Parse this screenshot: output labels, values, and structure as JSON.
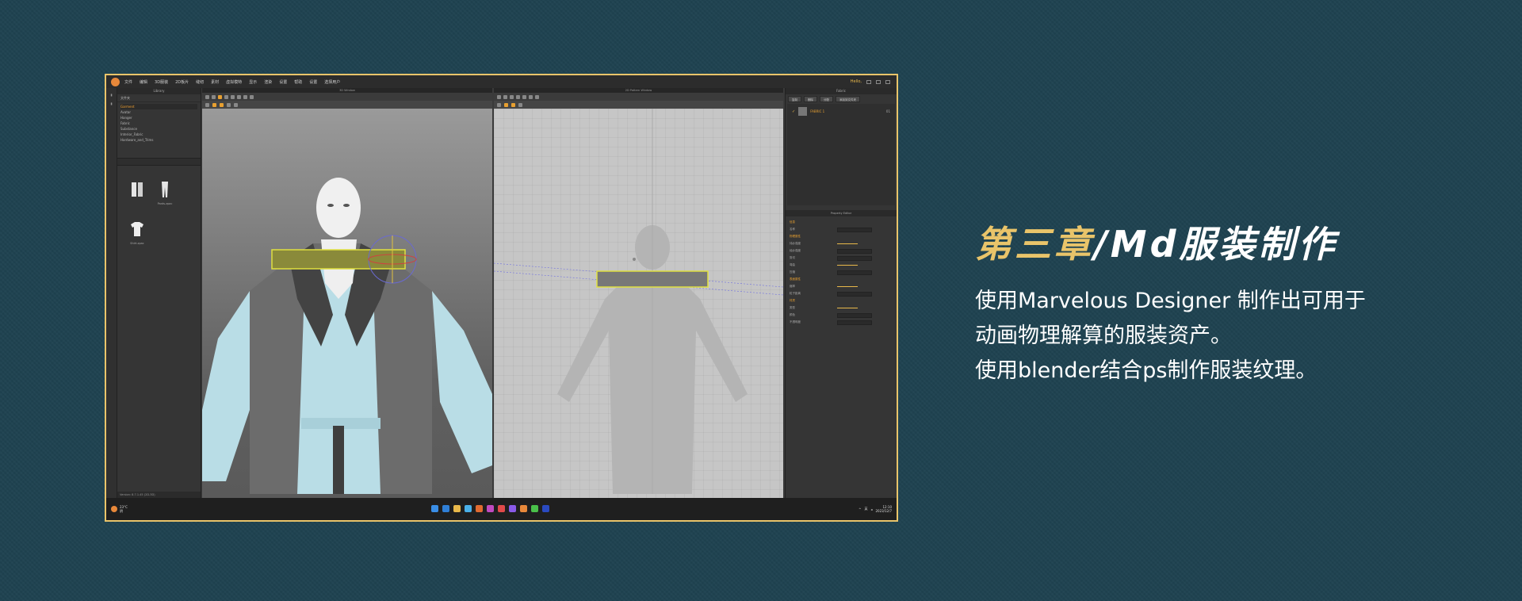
{
  "heading": {
    "primary": "第三章",
    "secondary": "/Md服装制作"
  },
  "description": [
    "使用Marvelous Designer 制作出可用于",
    "动画物理解算的服装资产。",
    "使用blender结合ps制作服装纹理。"
  ],
  "colors": {
    "background": "#1e4250",
    "accent": "#e9c46a",
    "text": "#ffffff"
  },
  "screenshot": {
    "menu": [
      "文件",
      "编辑",
      "3D服装",
      "2D板片",
      "缝纫",
      "素材",
      "虚拟模特",
      "显示",
      "渲染",
      "设置",
      "帮助",
      "设置",
      "选择用户"
    ],
    "user_name": "Hello,",
    "library": {
      "title": "Library",
      "toolbar_label": "文件夹",
      "folders": [
        "Garment",
        "Avatar",
        "Hanger",
        "Fabric",
        "Substance",
        "Interior_Fabric",
        "Hardware_and_Trims"
      ],
      "thumbnails": [
        "",
        "Pants.zpac",
        "Shirt.zpac"
      ],
      "footer": "Version: 8.7.1.45 (2D-3D)"
    },
    "view3d_title": "3D Window",
    "view2d_title": "2D Pattern Window",
    "fabric": {
      "title": "Fabric",
      "buttons": [
        "复制",
        "删除",
        "分配",
        "添加到文件夹"
      ],
      "item_name": "FABRIC 1",
      "item_count": "01"
    },
    "property_editor": {
      "title": "Property Editor",
      "rows": [
        {
          "label": "信息",
          "section": true
        },
        {
          "label": "名称",
          "section": false
        },
        {
          "label": "物理属性",
          "section": true
        },
        {
          "label": "纬纱强度",
          "section": false
        },
        {
          "label": "经纱强度",
          "section": false
        },
        {
          "label": "剪切",
          "section": false
        },
        {
          "label": "弯曲",
          "section": false
        },
        {
          "label": "压缩",
          "section": false
        },
        {
          "label": "表面属性",
          "section": true
        },
        {
          "label": "缩率",
          "section": false
        },
        {
          "label": "粒子距离",
          "section": false
        },
        {
          "label": "材质",
          "section": true
        },
        {
          "label": "类型",
          "section": false
        },
        {
          "label": "颜色",
          "section": false
        },
        {
          "label": "不透明度",
          "section": false
        }
      ]
    },
    "taskbar": {
      "weather_temp": "23°C",
      "weather_desc": "阴",
      "time": "12:10",
      "date": "2023/12/7",
      "lang": "英"
    }
  }
}
